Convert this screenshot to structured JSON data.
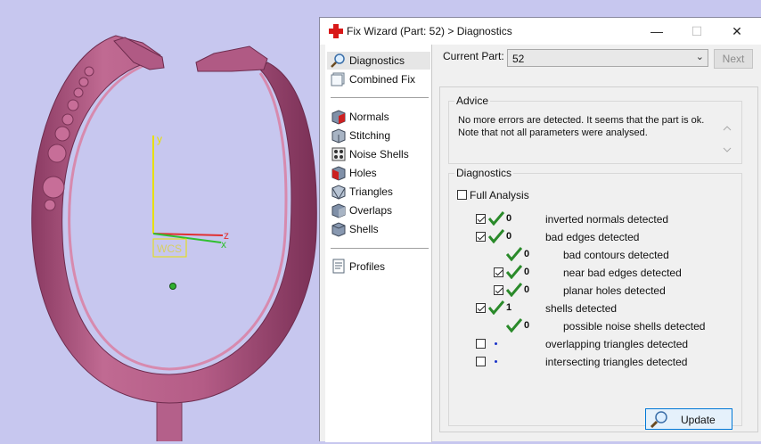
{
  "viewport": {
    "axes": {
      "y": "y",
      "z": "z",
      "x": "x"
    },
    "wcs_label": "WCS",
    "colors": {
      "background": "#c7c7ef",
      "ring": "#b25a82",
      "axis_y": "#e8e000",
      "axis_z": "#e03030",
      "axis_x": "#30c030"
    }
  },
  "window": {
    "title": "Fix Wizard (Part: 52) > Diagnostics",
    "title_icon": "red-cross-icon",
    "controls": {
      "minimize": "—",
      "maximize": "☐",
      "close": "✕"
    }
  },
  "sidebar": {
    "items_top": [
      {
        "label": "Diagnostics",
        "icon": "magnifier-icon",
        "selected": true
      },
      {
        "label": "Combined Fix",
        "icon": "combined-fix-icon"
      }
    ],
    "items_tools": [
      {
        "label": "Normals",
        "icon": "normals-icon"
      },
      {
        "label": "Stitching",
        "icon": "stitching-icon"
      },
      {
        "label": "Noise Shells",
        "icon": "noise-shells-icon"
      },
      {
        "label": "Holes",
        "icon": "holes-icon"
      },
      {
        "label": "Triangles",
        "icon": "triangles-icon"
      },
      {
        "label": "Overlaps",
        "icon": "overlaps-icon"
      },
      {
        "label": "Shells",
        "icon": "shells-icon"
      }
    ],
    "items_bottom": [
      {
        "label": "Profiles",
        "icon": "profiles-icon"
      }
    ]
  },
  "main": {
    "current_part_label": "Current Part:",
    "current_part_value": "52",
    "next_label": "Next",
    "advice": {
      "title": "Advice",
      "line1": "No more errors are detected. It seems that the part is ok.",
      "line2": "Note that not all parameters were analysed."
    },
    "diagnostics": {
      "title": "Diagnostics",
      "full_analysis_label": "Full Analysis",
      "full_analysis_checked": false,
      "rows": [
        {
          "checkbox": true,
          "checked": true,
          "status": "ok",
          "count": "0",
          "label": "inverted normals detected",
          "indent": 0
        },
        {
          "checkbox": true,
          "checked": true,
          "status": "ok",
          "count": "0",
          "label": "bad edges detected",
          "indent": 0
        },
        {
          "checkbox": false,
          "checked": false,
          "status": "ok",
          "count": "0",
          "label": "bad contours detected",
          "indent": 1
        },
        {
          "checkbox": true,
          "checked": true,
          "status": "ok",
          "count": "0",
          "label": "near bad edges detected",
          "indent": 1
        },
        {
          "checkbox": true,
          "checked": true,
          "status": "ok",
          "count": "0",
          "label": "planar holes detected",
          "indent": 1
        },
        {
          "checkbox": true,
          "checked": true,
          "status": "ok",
          "count": "1",
          "label": "shells detected",
          "indent": 0
        },
        {
          "checkbox": false,
          "checked": false,
          "status": "ok",
          "count": "0",
          "label": "possible noise shells detected",
          "indent": 1
        },
        {
          "checkbox": true,
          "checked": false,
          "status": "pending",
          "count": "",
          "label": "overlapping triangles detected",
          "indent": 0
        },
        {
          "checkbox": true,
          "checked": false,
          "status": "pending",
          "count": "",
          "label": "intersecting triangles detected",
          "indent": 0
        }
      ]
    },
    "update_label": "Update"
  }
}
